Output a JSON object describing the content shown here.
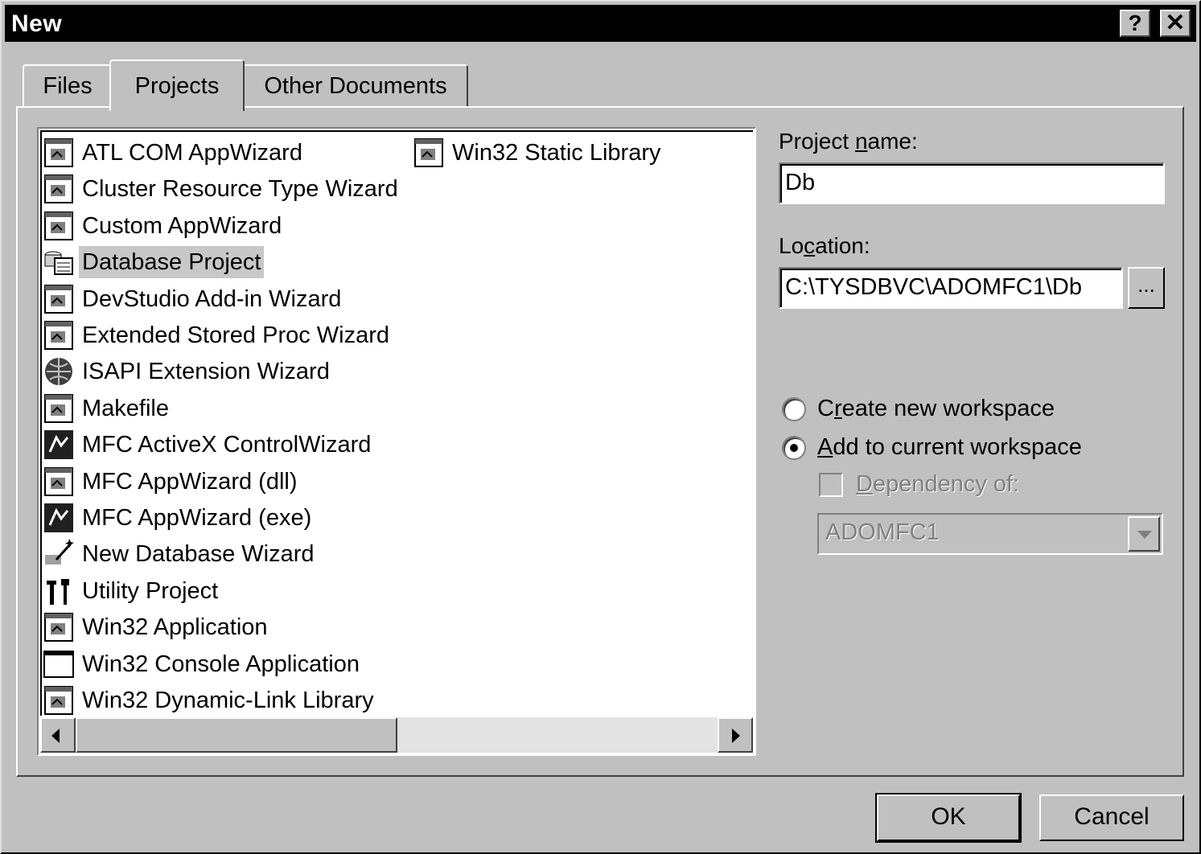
{
  "window": {
    "title": "New",
    "help_glyph": "?",
    "close_glyph": "✕"
  },
  "tabs": [
    {
      "label": "Files"
    },
    {
      "label": "Projects"
    },
    {
      "label": "Other Documents"
    }
  ],
  "projects": {
    "column1": [
      {
        "label": "ATL COM AppWizard",
        "icon": "atl-com-icon"
      },
      {
        "label": "Cluster Resource Type Wizard",
        "icon": "cluster-wizard-icon"
      },
      {
        "label": "Custom AppWizard",
        "icon": "custom-appwizard-icon"
      },
      {
        "label": "Database Project",
        "icon": "database-project-icon",
        "selected": true
      },
      {
        "label": "DevStudio Add-in Wizard",
        "icon": "devstudio-addin-icon"
      },
      {
        "label": "Extended Stored Proc Wizard",
        "icon": "stored-proc-icon"
      },
      {
        "label": "ISAPI Extension Wizard",
        "icon": "isapi-globe-icon"
      },
      {
        "label": "Makefile",
        "icon": "makefile-icon"
      },
      {
        "label": "MFC ActiveX ControlWizard",
        "icon": "activex-icon"
      },
      {
        "label": "MFC AppWizard (dll)",
        "icon": "mfc-dll-icon"
      },
      {
        "label": "MFC AppWizard (exe)",
        "icon": "mfc-exe-icon"
      },
      {
        "label": "New Database Wizard",
        "icon": "new-database-wand-icon"
      },
      {
        "label": "Utility Project",
        "icon": "utility-tools-icon"
      },
      {
        "label": "Win32 Application",
        "icon": "win32-app-icon"
      },
      {
        "label": "Win32 Console Application",
        "icon": "console-window-icon"
      },
      {
        "label": "Win32 Dynamic-Link Library",
        "icon": "dll-icon"
      }
    ],
    "column2": [
      {
        "label": "Win32 Static Library",
        "icon": "static-library-icon"
      }
    ]
  },
  "form": {
    "project_name_label_pre": "Project ",
    "project_name_label_u": "n",
    "project_name_label_post": "ame:",
    "project_name_value": "Db",
    "location_label_pre": "Lo",
    "location_label_u": "c",
    "location_label_post": "ation:",
    "location_value": "C:\\TYSDBVC\\ADOMFC1\\Db",
    "browse_label": "...",
    "create_new_pre": "C",
    "create_new_u": "r",
    "create_new_post": "eate new workspace",
    "add_current_u": "A",
    "add_current_post": "dd to current workspace",
    "dependency_u": "D",
    "dependency_post": "ependency of:",
    "dependency_value": "ADOMFC1",
    "workspace_choice": "add"
  },
  "buttons": {
    "ok": "OK",
    "cancel": "Cancel"
  },
  "colors": {
    "title_bg": "#000000",
    "face": "#c0c0c0",
    "selected_item": "#c8c8c8"
  }
}
